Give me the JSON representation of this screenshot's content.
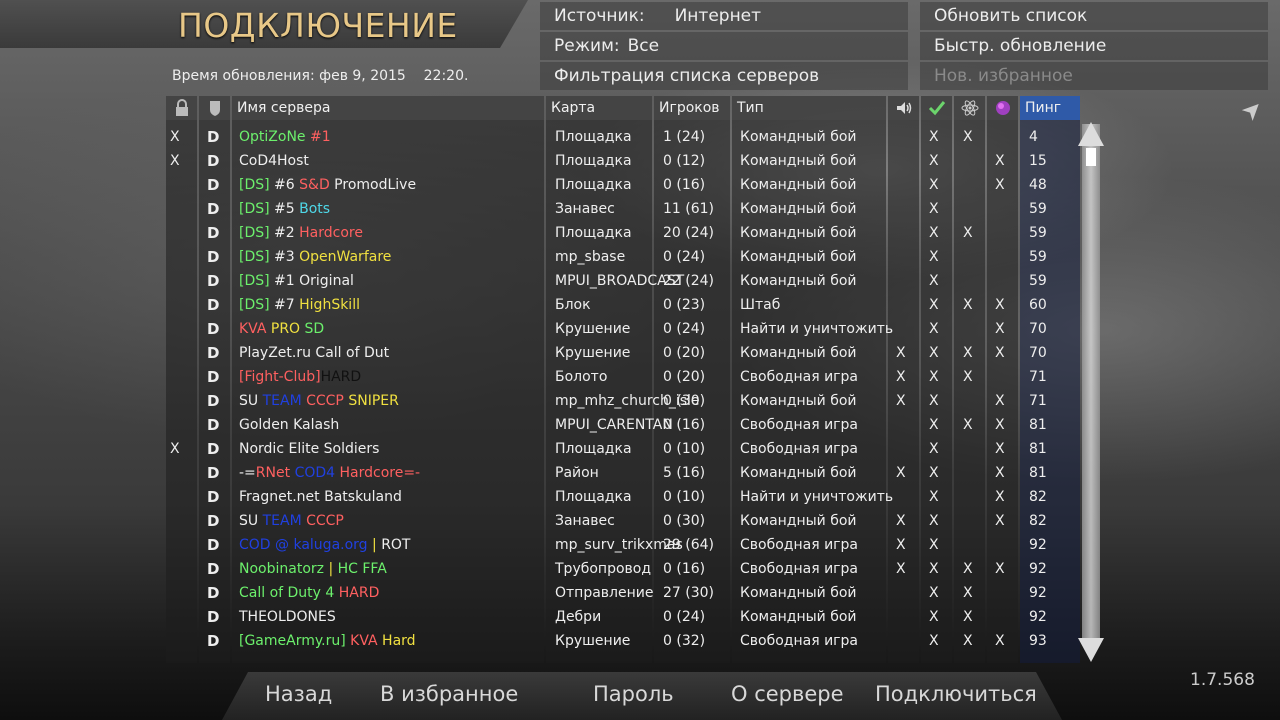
{
  "header": {
    "title": "ПОДКЛЮЧЕНИЕ",
    "updated": "Время обновления: фев 9, 2015    22:20."
  },
  "info": {
    "source_label": "Источник:",
    "source_value": "Интернет",
    "mode_label": "Режим:",
    "mode_value": "Все",
    "filter_label": "Фильтрация списка серверов"
  },
  "actions": {
    "refresh": "Обновить список",
    "quick_refresh": "Быстр. обновление",
    "new_favorite": "Нов. избранное"
  },
  "columns": {
    "server": "Имя сервера",
    "map": "Карта",
    "players": "Игроков",
    "type": "Тип",
    "ping": "Пинг"
  },
  "icons": {
    "col1": "lock-icon",
    "col2": "shield-icon",
    "col_voice": "speaker-icon",
    "col_pure": "checkmark-icon",
    "col_mod": "atom-icon",
    "col_hardcore": "globe-icon"
  },
  "colors": {
    "ping_header": "#2f5aa8",
    "title": "#e8c888"
  },
  "servers": [
    {
      "pw": "X",
      "d": "D",
      "name": [
        [
          "OptiZoNe ",
          "#6cf06c"
        ],
        [
          "#1",
          "#ff6060"
        ]
      ],
      "map": "Площадка",
      "players": "1 (24)",
      "type": "Командный бой",
      "voice": "",
      "pure": "X",
      "mod": "X",
      "hc": "",
      "ping": "4"
    },
    {
      "pw": "X",
      "d": "D",
      "name": [
        [
          "CoD4Host",
          "#eeeeee"
        ]
      ],
      "map": "Площадка",
      "players": "0 (12)",
      "type": "Командный бой",
      "voice": "",
      "pure": "X",
      "mod": "",
      "hc": "X",
      "ping": "15"
    },
    {
      "pw": "",
      "d": "D",
      "name": [
        [
          "[DS]",
          "#6cf06c"
        ],
        [
          " #6 ",
          "#eeeeee"
        ],
        [
          "S&D",
          "#ff6060"
        ],
        [
          " PromodLive",
          "#eeeeee"
        ]
      ],
      "map": "Площадка",
      "players": "0 (16)",
      "type": "Командный бой",
      "voice": "",
      "pure": "X",
      "mod": "",
      "hc": "X",
      "ping": "48"
    },
    {
      "pw": "",
      "d": "D",
      "name": [
        [
          "[DS]",
          "#6cf06c"
        ],
        [
          " #5 ",
          "#eeeeee"
        ],
        [
          "Bots",
          "#4fd8e8"
        ]
      ],
      "map": "Занавес",
      "players": "11 (61)",
      "type": "Командный бой",
      "voice": "",
      "pure": "X",
      "mod": "",
      "hc": "",
      "ping": "59"
    },
    {
      "pw": "",
      "d": "D",
      "name": [
        [
          "[DS]",
          "#6cf06c"
        ],
        [
          " #2 ",
          "#eeeeee"
        ],
        [
          "Hardcore",
          "#ff6060"
        ]
      ],
      "map": "Площадка",
      "players": "20 (24)",
      "type": "Командный бой",
      "voice": "",
      "pure": "X",
      "mod": "X",
      "hc": "",
      "ping": "59"
    },
    {
      "pw": "",
      "d": "D",
      "name": [
        [
          "[DS]",
          "#6cf06c"
        ],
        [
          " #3 ",
          "#eeeeee"
        ],
        [
          "OpenWarfare",
          "#f0e040"
        ]
      ],
      "map": "mp_sbase",
      "players": "0 (24)",
      "type": "Командный бой",
      "voice": "",
      "pure": "X",
      "mod": "",
      "hc": "",
      "ping": "59"
    },
    {
      "pw": "",
      "d": "D",
      "name": [
        [
          "[DS]",
          "#6cf06c"
        ],
        [
          " #1 Original",
          "#eeeeee"
        ]
      ],
      "map": "MPUI_BROADCAST",
      "players": "22 (24)",
      "type": "Командный бой",
      "voice": "",
      "pure": "X",
      "mod": "",
      "hc": "",
      "ping": "59"
    },
    {
      "pw": "",
      "d": "D",
      "name": [
        [
          "[DS]",
          "#6cf06c"
        ],
        [
          " #7 ",
          "#eeeeee"
        ],
        [
          "HighSkill",
          "#f0e040"
        ]
      ],
      "map": "Блок",
      "players": "0 (23)",
      "type": "Штаб",
      "voice": "",
      "pure": "X",
      "mod": "X",
      "hc": "X",
      "ping": "60"
    },
    {
      "pw": "",
      "d": "D",
      "name": [
        [
          "KVA ",
          "#ff6060"
        ],
        [
          "PRO ",
          "#f0e040"
        ],
        [
          "SD",
          "#6cf06c"
        ]
      ],
      "map": "Крушение",
      "players": "0 (24)",
      "type": "Найти и уничтожить",
      "voice": "",
      "pure": "X",
      "mod": "",
      "hc": "X",
      "ping": "70"
    },
    {
      "pw": "",
      "d": "D",
      "name": [
        [
          "PlayZet.ru Call of Dut",
          "#eeeeee"
        ]
      ],
      "map": "Крушение",
      "players": "0 (20)",
      "type": "Командный бой",
      "voice": "X",
      "pure": "X",
      "mod": "X",
      "hc": "X",
      "ping": "70"
    },
    {
      "pw": "",
      "d": "D",
      "name": [
        [
          "[Fight-Club]",
          "#ff6060"
        ],
        [
          "HARD",
          "#111111"
        ]
      ],
      "map": "Болото",
      "players": "0 (20)",
      "type": "Свободная игра",
      "voice": "X",
      "pure": "X",
      "mod": "X",
      "hc": "",
      "ping": "71"
    },
    {
      "pw": "",
      "d": "D",
      "name": [
        [
          "SU ",
          "#eeeeee"
        ],
        [
          "TEAM ",
          "#2040e0"
        ],
        [
          "CCCP ",
          "#ff6060"
        ],
        [
          "SNIPER",
          "#f0e040"
        ]
      ],
      "map": "mp_mhz_church_isle",
      "players": "0 (30)",
      "type": "Командный бой",
      "voice": "X",
      "pure": "X",
      "mod": "",
      "hc": "X",
      "ping": "71"
    },
    {
      "pw": "",
      "d": "D",
      "name": [
        [
          "Golden Kalash",
          "#eeeeee"
        ]
      ],
      "map": "MPUI_CARENTAN",
      "players": "0 (16)",
      "type": "Свободная игра",
      "voice": "",
      "pure": "X",
      "mod": "X",
      "hc": "X",
      "ping": "81"
    },
    {
      "pw": "X",
      "d": "D",
      "name": [
        [
          "Nordic Elite Soldiers",
          "#eeeeee"
        ]
      ],
      "map": "Площадка",
      "players": "0 (10)",
      "type": "Свободная игра",
      "voice": "",
      "pure": "X",
      "mod": "",
      "hc": "X",
      "ping": "81"
    },
    {
      "pw": "",
      "d": "D",
      "name": [
        [
          "-=",
          "#eeeeee"
        ],
        [
          "RNet ",
          "#ff6060"
        ],
        [
          "COD4 ",
          "#2040e0"
        ],
        [
          "Hardcore=-",
          "#ff6060"
        ]
      ],
      "map": "Район",
      "players": "5 (16)",
      "type": "Командный бой",
      "voice": "X",
      "pure": "X",
      "mod": "",
      "hc": "X",
      "ping": "81"
    },
    {
      "pw": "",
      "d": "D",
      "name": [
        [
          "Fragnet.net Batskuland",
          "#eeeeee"
        ]
      ],
      "map": "Площадка",
      "players": "0 (10)",
      "type": "Найти и уничтожить",
      "voice": "",
      "pure": "X",
      "mod": "",
      "hc": "X",
      "ping": "82"
    },
    {
      "pw": "",
      "d": "D",
      "name": [
        [
          "SU ",
          "#eeeeee"
        ],
        [
          "TEAM ",
          "#2040e0"
        ],
        [
          "CCCP",
          "#ff6060"
        ]
      ],
      "map": "Занавес",
      "players": "0 (30)",
      "type": "Командный бой",
      "voice": "X",
      "pure": "X",
      "mod": "",
      "hc": "X",
      "ping": "82"
    },
    {
      "pw": "",
      "d": "D",
      "name": [
        [
          "COD @ kaluga.org",
          "#2040e0"
        ],
        [
          " | ",
          "#f0e040"
        ],
        [
          "ROT",
          "#eeeeee"
        ]
      ],
      "map": "mp_surv_trikxmas",
      "players": "29 (64)",
      "type": "Свободная игра",
      "voice": "X",
      "pure": "X",
      "mod": "",
      "hc": "",
      "ping": "92"
    },
    {
      "pw": "",
      "d": "D",
      "name": [
        [
          "Noobinatorz",
          "#6cf06c"
        ],
        [
          " | ",
          "#f0e040"
        ],
        [
          "HC FFA",
          "#6cf06c"
        ]
      ],
      "map": "Трубопровод",
      "players": "0 (16)",
      "type": "Свободная игра",
      "voice": "X",
      "pure": "X",
      "mod": "X",
      "hc": "X",
      "ping": "92"
    },
    {
      "pw": "",
      "d": "D",
      "name": [
        [
          "Call of Duty 4 ",
          "#6cf06c"
        ],
        [
          "HARD",
          "#ff6060"
        ]
      ],
      "map": "Отправление",
      "players": "27 (30)",
      "type": "Командный бой",
      "voice": "",
      "pure": "X",
      "mod": "X",
      "hc": "",
      "ping": "92"
    },
    {
      "pw": "",
      "d": "D",
      "name": [
        [
          "THEOLDONES",
          "#eeeeee"
        ]
      ],
      "map": "Дебри",
      "players": "0 (24)",
      "type": "Командный бой",
      "voice": "",
      "pure": "X",
      "mod": "X",
      "hc": "",
      "ping": "92"
    },
    {
      "pw": "",
      "d": "D",
      "name": [
        [
          "[GameArmy.ru]",
          "#6cf06c"
        ],
        [
          " KVA ",
          "#ff6060"
        ],
        [
          "Hard",
          "#f0e040"
        ]
      ],
      "map": "Крушение",
      "players": "0 (32)",
      "type": "Свободная игра",
      "voice": "",
      "pure": "X",
      "mod": "X",
      "hc": "X",
      "ping": "93"
    }
  ],
  "buttons": {
    "back": "Назад",
    "favorite": "В избранное",
    "password": "Пароль",
    "info": "О сервере",
    "connect": "Подключиться"
  },
  "version": "1.7.568"
}
